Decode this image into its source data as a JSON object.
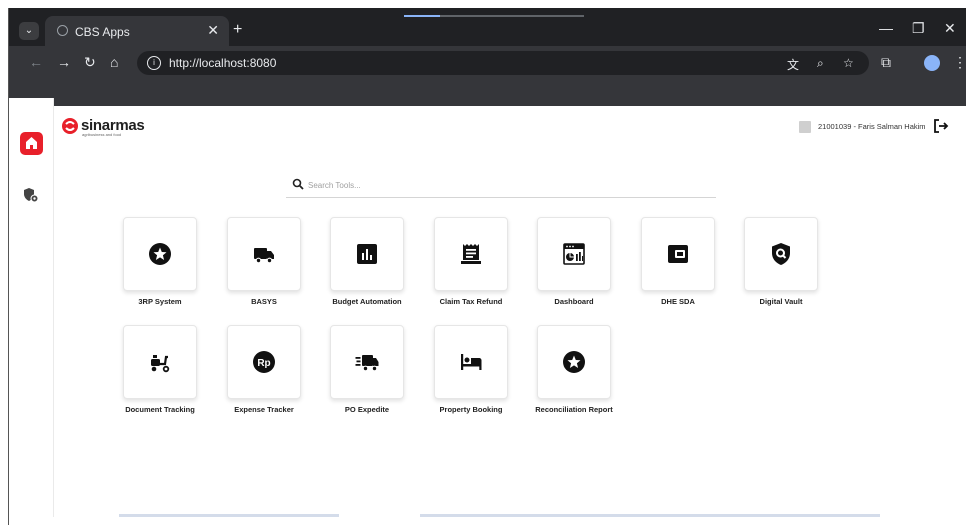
{
  "browser": {
    "tab_title": "CBS Apps",
    "url": "http://localhost:8080",
    "tab_close": "✕",
    "new_tab": "+",
    "minimize": "—",
    "restore": "❐",
    "close": "✕",
    "back": "←",
    "forward": "→",
    "reload": "↻",
    "home": "⌂",
    "menu": "⋮"
  },
  "header": {
    "logo_text": "sinarmas",
    "logo_sub": "agribusiness and food",
    "user_label": "21001039 - Faris Salman Hakim"
  },
  "search": {
    "placeholder": "Search Tools..."
  },
  "apps": [
    {
      "label": "3RP System",
      "icon": "star-circle-icon"
    },
    {
      "label": "BASYS",
      "icon": "truck-icon"
    },
    {
      "label": "Budget Automation",
      "icon": "bar-chart-icon"
    },
    {
      "label": "Claim Tax Refund",
      "icon": "receipt-icon"
    },
    {
      "label": "Dashboard",
      "icon": "dashboard-icon"
    },
    {
      "label": "DHE SDA",
      "icon": "wallet-icon"
    },
    {
      "label": "Digital Vault",
      "icon": "shield-search-icon"
    },
    {
      "label": "Document Tracking",
      "icon": "scooter-icon"
    },
    {
      "label": "Expense Tracker",
      "icon": "rupiah-icon"
    },
    {
      "label": "PO Expedite",
      "icon": "fast-truck-icon"
    },
    {
      "label": "Property Booking",
      "icon": "bed-icon"
    },
    {
      "label": "Reconciliation Report",
      "icon": "star-circle-icon"
    }
  ],
  "colors": {
    "accent": "#e8202a",
    "chrome_dark": "#202124",
    "chrome_toolbar": "#35363a"
  }
}
